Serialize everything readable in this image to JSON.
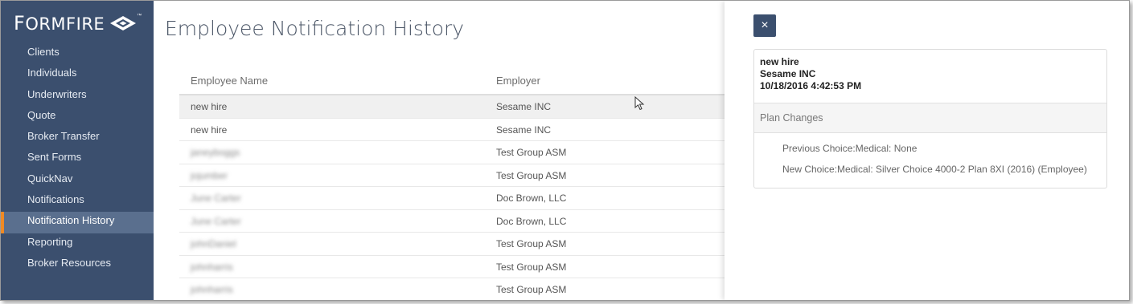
{
  "brand": {
    "name_cap": "F",
    "name_rest": "ORMFIRE",
    "tm": "™"
  },
  "sidebar": {
    "items": [
      {
        "label": "Clients",
        "active": false
      },
      {
        "label": "Individuals",
        "active": false
      },
      {
        "label": "Underwriters",
        "active": false
      },
      {
        "label": "Quote",
        "active": false
      },
      {
        "label": "Broker Transfer",
        "active": false
      },
      {
        "label": "Sent Forms",
        "active": false
      },
      {
        "label": "QuickNav",
        "active": false
      },
      {
        "label": "Notifications",
        "active": false
      },
      {
        "label": "Notification History",
        "active": true
      },
      {
        "label": "Reporting",
        "active": false
      },
      {
        "label": "Broker Resources",
        "active": false
      }
    ]
  },
  "main": {
    "title": "Employee Notification History",
    "columns": [
      "Employee Name",
      "Employer"
    ],
    "rows": [
      {
        "name": "new hire",
        "employer": "Sesame INC",
        "blurred": false,
        "selected": true
      },
      {
        "name": "new hire",
        "employer": "Sesame INC",
        "blurred": false,
        "selected": false
      },
      {
        "name": "janeyboggs",
        "employer": "Test Group ASM",
        "blurred": true,
        "selected": false
      },
      {
        "name": "jojumber",
        "employer": "Test Group ASM",
        "blurred": true,
        "selected": false
      },
      {
        "name": "June Carter",
        "employer": "Doc Brown, LLC",
        "blurred": true,
        "selected": false
      },
      {
        "name": "June Carter",
        "employer": "Doc Brown, LLC",
        "blurred": true,
        "selected": false
      },
      {
        "name": "johnDaniel",
        "employer": "Test Group ASM",
        "blurred": true,
        "selected": false
      },
      {
        "name": "johnharris",
        "employer": "Test Group ASM",
        "blurred": true,
        "selected": false
      },
      {
        "name": "johnharris",
        "employer": "Test Group ASM",
        "blurred": true,
        "selected": false
      }
    ]
  },
  "detail": {
    "close_label": "×",
    "employee": "new hire",
    "employer": "Sesame INC",
    "timestamp": "10/18/2016 4:42:53 PM",
    "section_title": "Plan Changes",
    "changes": [
      "Previous Choice:Medical: None",
      "New Choice:Medical: Silver Choice 4000-2 Plan 8XI (2016) (Employee)"
    ]
  },
  "colors": {
    "sidebar_bg": "#3b4f6e",
    "active_bg": "#5a6f8e",
    "active_accent": "#f08a24"
  }
}
